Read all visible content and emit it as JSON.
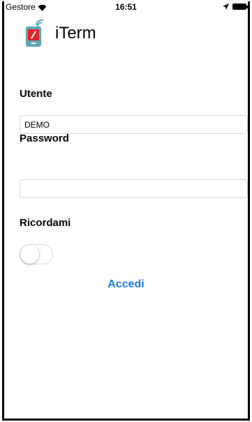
{
  "status_bar": {
    "carrier": "Gestore",
    "time": "16:51"
  },
  "app": {
    "title": "iTerm"
  },
  "form": {
    "username_label": "Utente",
    "username_value": "DEMO",
    "password_label": "Password",
    "password_value": "",
    "remember_label": "Ricordami",
    "remember_on": false,
    "login_label": "Accedi"
  },
  "colors": {
    "accent": "#1a7cf0",
    "logo_red": "#e0242b",
    "logo_teal": "#5aa9b8"
  }
}
